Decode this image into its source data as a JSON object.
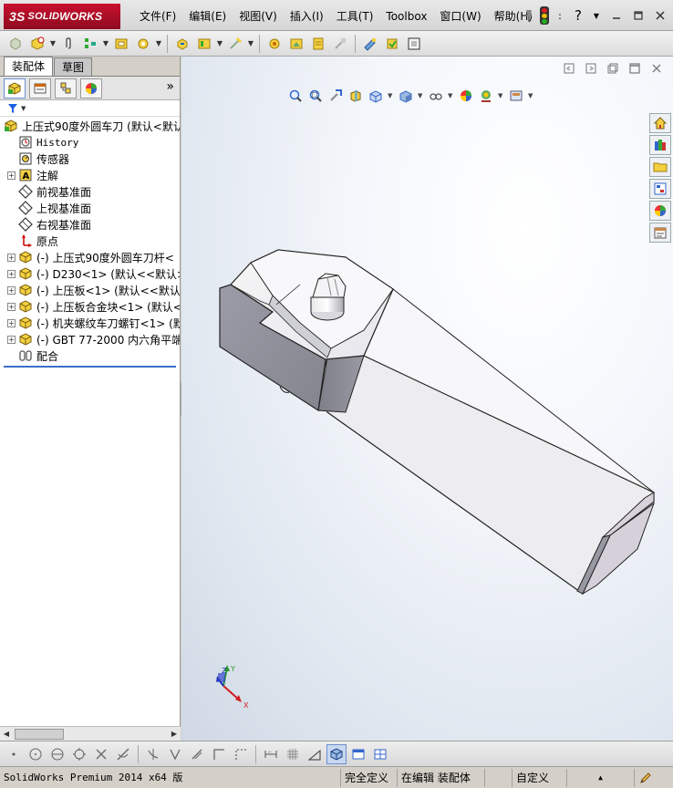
{
  "app": {
    "logo_ds": "3S",
    "logo_solid": "SOLID",
    "logo_works": "WORKS"
  },
  "menu": {
    "items": [
      "文件(F)",
      "编辑(E)",
      "视图(V)",
      "插入(I)",
      "工具(T)",
      "Toolbox",
      "窗口(W)",
      "帮助(H)"
    ]
  },
  "panel": {
    "tabs": [
      "装配体",
      "草图"
    ],
    "more": "»"
  },
  "tree": {
    "root": "上压式90度外圆车刀  (默认<默认",
    "items": [
      {
        "label": "History",
        "icon": "history-icon",
        "mono": true,
        "expandable": false
      },
      {
        "label": "传感器",
        "icon": "sensor-icon",
        "mono": false,
        "expandable": false
      },
      {
        "label": "注解",
        "icon": "annotation-icon",
        "mono": false,
        "expandable": true
      },
      {
        "label": "前视基准面",
        "icon": "plane-icon",
        "mono": false,
        "expandable": false
      },
      {
        "label": "上视基准面",
        "icon": "plane-icon",
        "mono": false,
        "expandable": false
      },
      {
        "label": "右视基准面",
        "icon": "plane-icon",
        "mono": false,
        "expandable": false
      },
      {
        "label": "原点",
        "icon": "origin-icon",
        "mono": false,
        "expandable": false
      },
      {
        "label": "(-) 上压式90度外圆车刀杆<",
        "icon": "part-icon",
        "mono": false,
        "expandable": true
      },
      {
        "label": "(-) D230<1> (默认<<默认>_显",
        "icon": "part-icon",
        "mono": false,
        "expandable": true
      },
      {
        "label": "(-) 上压板<1> (默认<<默认>",
        "icon": "part-icon",
        "mono": false,
        "expandable": true
      },
      {
        "label": "(-) 上压板合金块<1> (默认<",
        "icon": "part-icon",
        "mono": false,
        "expandable": true
      },
      {
        "label": "(-) 机夹螺纹车刀螺钉<1> (默",
        "icon": "part-icon",
        "mono": false,
        "expandable": true
      },
      {
        "label": "(-) GBT 77-2000 内六角平端",
        "icon": "part-icon",
        "mono": false,
        "expandable": true
      },
      {
        "label": "配合",
        "icon": "mate-icon",
        "mono": false,
        "expandable": false
      }
    ]
  },
  "triad": {
    "x": "X",
    "y": "Y",
    "z": "Z"
  },
  "status": {
    "version": "SolidWorks Premium 2014 x64 版",
    "definition": "完全定义",
    "editing": "在编辑 装配体",
    "units": "自定义"
  },
  "colors": {
    "accent": "#c8102e",
    "selection_line": "#3a70c8"
  }
}
